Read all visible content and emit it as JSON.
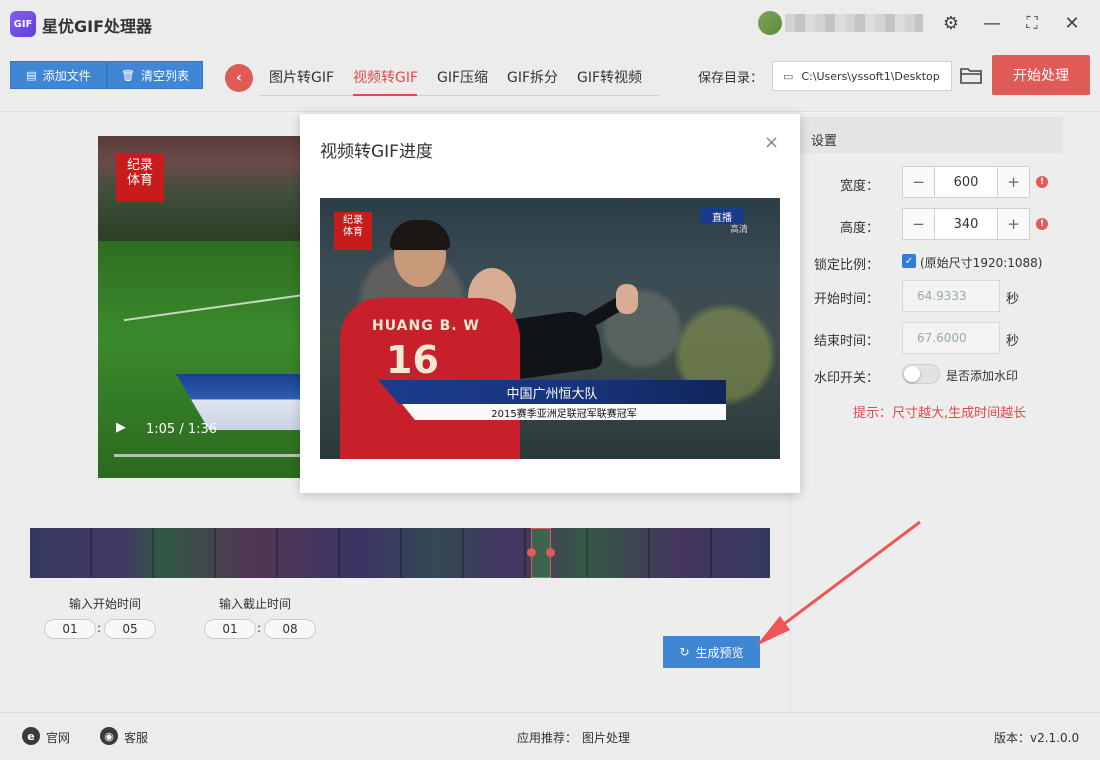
{
  "app": {
    "title": "星优GIF处理器",
    "logo_text": "GIF"
  },
  "window": {
    "settings_glyph": "⚙",
    "min_glyph": "—",
    "max_glyph": "⛶",
    "close_glyph": "✕"
  },
  "toolbar": {
    "add_file": "添加文件",
    "clear_list": "清空列表",
    "back_glyph": "‹",
    "tabs": [
      "图片转GIF",
      "视频转GIF",
      "GIF压缩",
      "GIF拆分",
      "GIF转视频"
    ],
    "active_tab": 1,
    "save_label": "保存目录：",
    "save_path": "C:\\Users\\yssoft1\\Desktop",
    "start_button": "开始处理"
  },
  "video": {
    "current_time": "1:05",
    "duration": "1:36",
    "time_display": "1:05 / 1:36",
    "logo_line1": "纪录",
    "logo_line2": "体育"
  },
  "trim": {
    "start_label": "输入开始时间",
    "end_label": "输入截止时间",
    "start_min": "01",
    "start_sec": "05",
    "end_min": "01",
    "end_sec": "08",
    "preview_button": "生成预览"
  },
  "settings": {
    "header": "设置",
    "width_label": "宽度：",
    "width_value": "600",
    "height_label": "高度：",
    "height_value": "340",
    "lock_label": "锁定比例：",
    "lock_checked": true,
    "lock_text": "(原始尺寸1920:1088)",
    "start_label": "开始时间：",
    "start_value": "64.9333",
    "end_label": "结束时间：",
    "end_value": "67.6000",
    "unit": "秒",
    "watermark_label": "水印开关：",
    "watermark_text": "是否添加水印",
    "hint": "提示：尺寸越大,生成时间越长"
  },
  "modal": {
    "title": "视频转GIF进度",
    "close_glyph": "×",
    "frame": {
      "logo_line1": "纪录",
      "logo_line2": "体育",
      "live": "直播",
      "live_sub": "高清",
      "jersey_name": "HUANG B. W",
      "jersey_number": "16",
      "caption_main": "中国广州恒大队",
      "caption_sub": "2015赛季亚洲足联冠军联赛冠军"
    }
  },
  "footer": {
    "website": "官网",
    "support": "客服",
    "recommend_label": "应用推荐：",
    "recommend_value": "图片处理",
    "version": "版本：v2.1.0.0"
  },
  "colors": {
    "accent_red": "#e05a56",
    "accent_blue": "#3f86d4",
    "hint_red": "#e04b4b"
  }
}
